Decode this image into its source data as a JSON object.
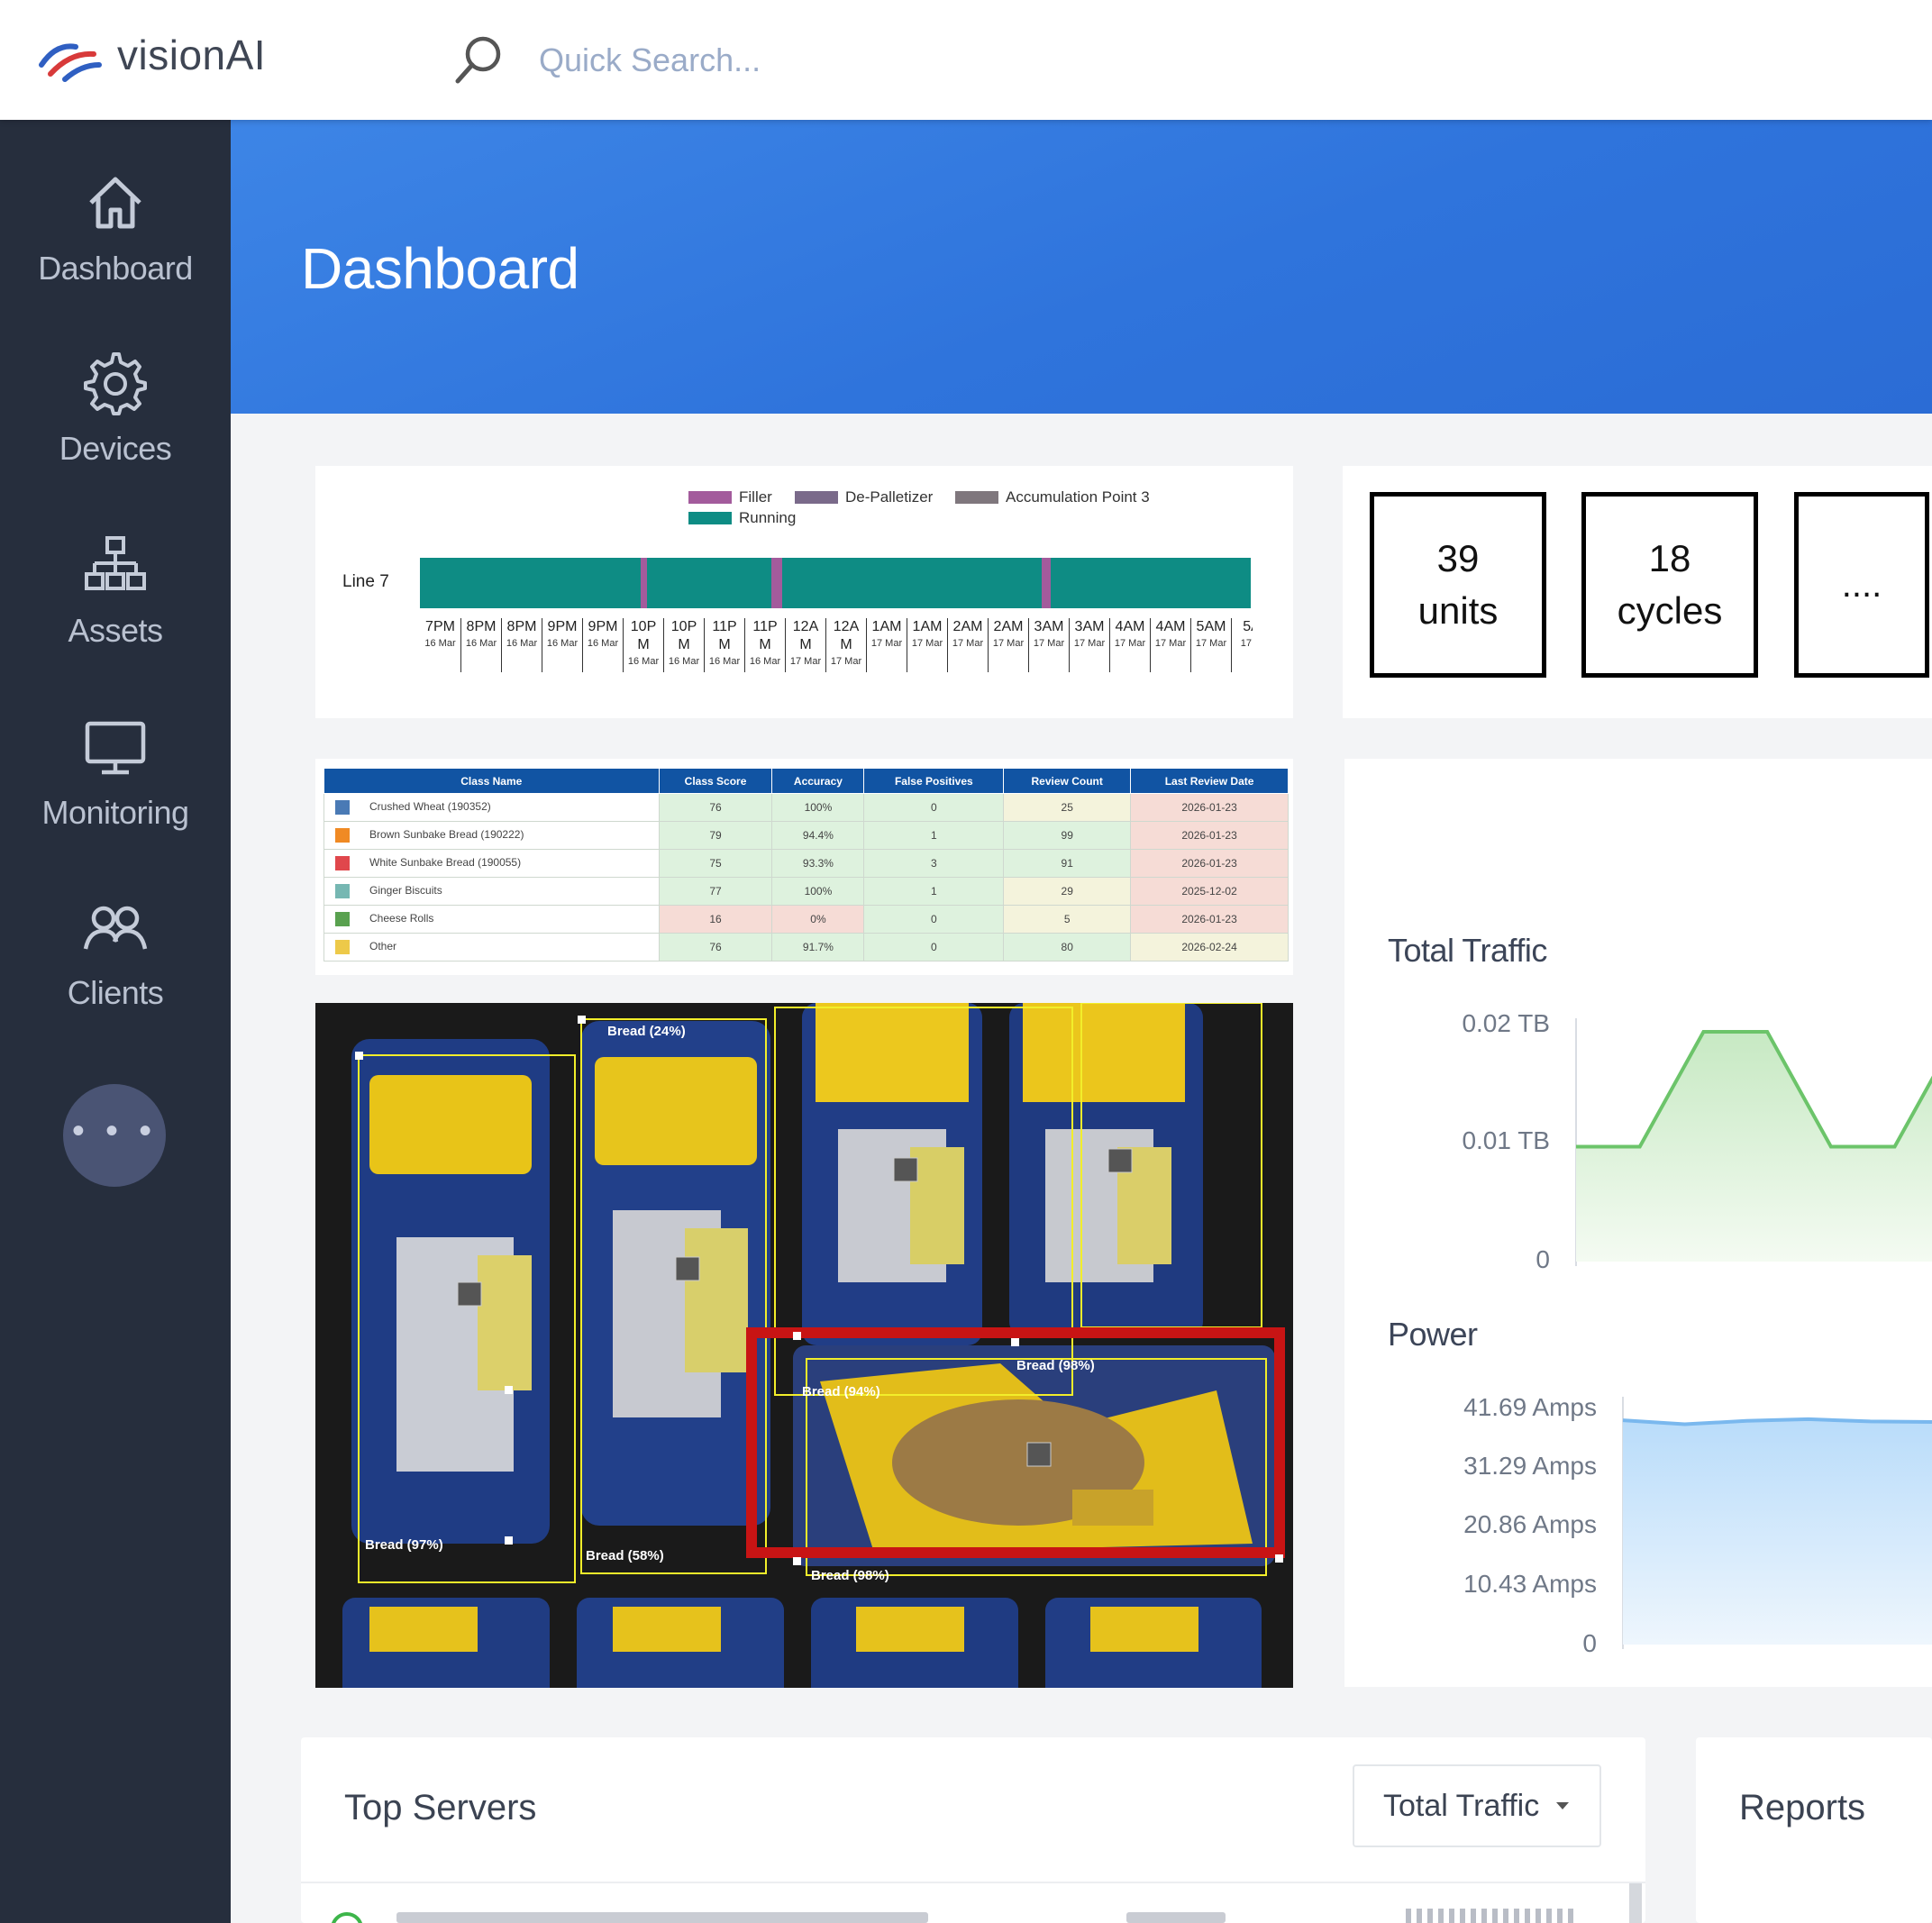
{
  "app": {
    "brand": "visionAI"
  },
  "search": {
    "placeholder": "Quick Search..."
  },
  "sidebar": {
    "items": [
      {
        "label": "Dashboard",
        "icon": "home-icon"
      },
      {
        "label": "Devices",
        "icon": "gear-icon"
      },
      {
        "label": "Assets",
        "icon": "hierarchy-icon"
      },
      {
        "label": "Monitoring",
        "icon": "monitor-icon"
      },
      {
        "label": "Clients",
        "icon": "users-icon"
      }
    ],
    "more": "• • •"
  },
  "header": {
    "title": "Dashboard"
  },
  "timeline": {
    "legend": [
      {
        "label": "Filler",
        "color": "#a35b9c"
      },
      {
        "label": "De-Palletizer",
        "color": "#7a6a8a"
      },
      {
        "label": "Accumulation Point 3",
        "color": "#7f777d"
      },
      {
        "label": "Running",
        "color": "#0e8c84"
      }
    ],
    "line_label": "Line 7",
    "ticks": [
      {
        "t": "7PM",
        "d": "16 Mar"
      },
      {
        "t": "8PM",
        "d": "16 Mar"
      },
      {
        "t": "8PM",
        "d": "16 Mar"
      },
      {
        "t": "9PM",
        "d": "16 Mar"
      },
      {
        "t": "9PM",
        "d": "16 Mar"
      },
      {
        "t": "10P M",
        "d": "16 Mar"
      },
      {
        "t": "10P M",
        "d": "16 Mar"
      },
      {
        "t": "11P M",
        "d": "16 Mar"
      },
      {
        "t": "11P M",
        "d": "16 Mar"
      },
      {
        "t": "12A M",
        "d": "17 Mar"
      },
      {
        "t": "12A M",
        "d": "17 Mar"
      },
      {
        "t": "1AM",
        "d": "17 Mar"
      },
      {
        "t": "1AM",
        "d": "17 Mar"
      },
      {
        "t": "2AM",
        "d": "17 Mar"
      },
      {
        "t": "2AM",
        "d": "17 Mar"
      },
      {
        "t": "3AM",
        "d": "17 Mar"
      },
      {
        "t": "3AM",
        "d": "17 Mar"
      },
      {
        "t": "4AM",
        "d": "17 Mar"
      },
      {
        "t": "4AM",
        "d": "17 Mar"
      },
      {
        "t": "5AM",
        "d": "17 Mar"
      },
      {
        "t": "5A",
        "d": "17 M"
      }
    ]
  },
  "stats": [
    {
      "value": "39",
      "unit": "units"
    },
    {
      "value": "18",
      "unit": "cycles"
    },
    {
      "value": "....",
      "unit": ""
    }
  ],
  "class_table": {
    "headers": [
      "Class Name",
      "Class Score",
      "Accuracy",
      "False Positives",
      "Review Count",
      "Last Review Date"
    ],
    "rows": [
      {
        "color": "#4a7ab5",
        "name": "Crushed Wheat (190352)",
        "score": "76",
        "accuracy": "100%",
        "fp": "0",
        "count": "25",
        "date": "2026-01-23"
      },
      {
        "color": "#f08a24",
        "name": "Brown Sunbake Bread (190222)",
        "score": "79",
        "accuracy": "94.4%",
        "fp": "1",
        "count": "99",
        "date": "2026-01-23"
      },
      {
        "color": "#e0474c",
        "name": "White Sunbake Bread (190055)",
        "score": "75",
        "accuracy": "93.3%",
        "fp": "3",
        "count": "91",
        "date": "2026-01-23"
      },
      {
        "color": "#76b7b2",
        "name": "Ginger Biscuits",
        "score": "77",
        "accuracy": "100%",
        "fp": "1",
        "count": "29",
        "date": "2025-12-02"
      },
      {
        "color": "#59a14f",
        "name": "Cheese Rolls",
        "score": "16",
        "accuracy": "0%",
        "fp": "0",
        "count": "5",
        "date": "2026-01-23"
      },
      {
        "color": "#edc949",
        "name": "Other",
        "score": "76",
        "accuracy": "91.7%",
        "fp": "0",
        "count": "80",
        "date": "2026-02-24"
      }
    ]
  },
  "detections": [
    "Bread (24%)",
    "Bread (97%)",
    "Bread (58%)",
    "Bread (94%)",
    "Bread (98%)",
    "Bread (98%)"
  ],
  "traffic_chart": {
    "title": "Total Traffic",
    "yticks": [
      "0.02 TB",
      "0.01 TB",
      "0"
    ]
  },
  "power_chart": {
    "title": "Power",
    "yticks": [
      "41.69 Amps",
      "31.29 Amps",
      "20.86 Amps",
      "10.43 Amps",
      "0"
    ]
  },
  "chart_data": [
    {
      "type": "area",
      "title": "Total Traffic",
      "ylabel": "",
      "ylim": [
        0,
        0.02
      ],
      "unit": "TB",
      "x": [
        0,
        1,
        2,
        3,
        4,
        5,
        6,
        7
      ],
      "values": [
        0.01,
        0.01,
        0.02,
        0.02,
        0.01,
        0.01,
        0.02,
        0.02
      ]
    },
    {
      "type": "area",
      "title": "Power",
      "ylabel": "",
      "ylim": [
        0,
        41.69
      ],
      "unit": "Amps",
      "x": [
        0,
        1,
        2,
        3,
        4,
        5
      ],
      "values": [
        39.9,
        39.2,
        39.8,
        40.1,
        39.7,
        39.6
      ]
    }
  ],
  "top_servers": {
    "title": "Top Servers",
    "dropdown": "Total Traffic"
  },
  "reports": {
    "title": "Reports"
  }
}
